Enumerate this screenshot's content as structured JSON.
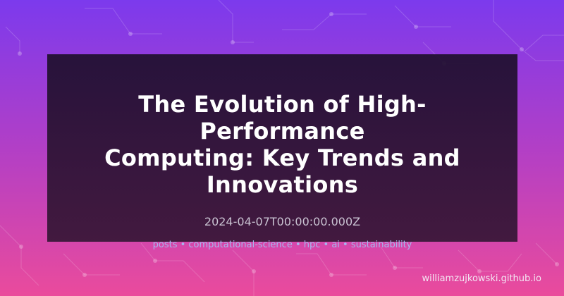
{
  "post": {
    "title_line1": "The Evolution of High-Performance",
    "title_line2": "Computing: Key Trends and",
    "title_line3": "Innovations",
    "date": "2024-04-07T00:00:00.000Z",
    "tags": "posts • computational-science • hpc • ai • sustainability"
  },
  "footer": {
    "site": "williamzujkowski.github.io"
  },
  "colors": {
    "gradient_top": "#7c3aed",
    "gradient_bottom": "#ea4b9c",
    "card_background": "#2a1438",
    "title": "#ffffff",
    "date": "#c9c3d2",
    "tags": "#a6b6ee"
  }
}
